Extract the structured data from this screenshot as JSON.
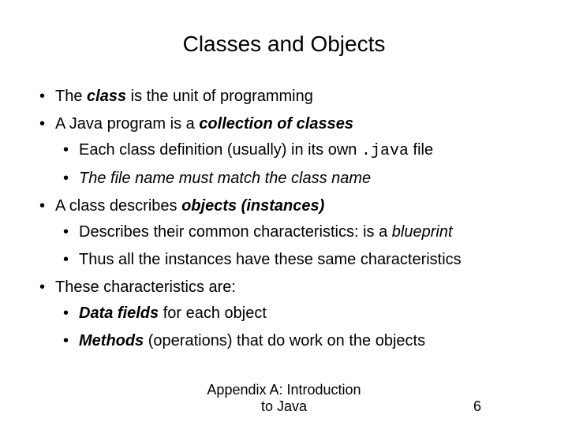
{
  "title": "Classes and Objects",
  "bullets": {
    "b1_pre": "The ",
    "b1_bold": "class",
    "b1_post": " is the unit of programming",
    "b2_pre": "A Java program is a ",
    "b2_bold": "collection of classes",
    "b2s1_pre": "Each class definition (usually) in its own ",
    "b2s1_mono": ".java",
    "b2s1_post": " file",
    "b2s2": "The file name must match the class name",
    "b3_pre": "A class describes ",
    "b3_bold": "objects (instances)",
    "b3s1_pre": "Describes their common characteristics: is a ",
    "b3s1_italic": "blueprint",
    "b3s2": "Thus all the instances have these same characteristics",
    "b4": "These characteristics are:",
    "b4s1_bold": "Data fields",
    "b4s1_post": " for each object",
    "b4s2_bold": "Methods",
    "b4s2_post": " (operations) that do work on the objects"
  },
  "footer": {
    "line1": "Appendix A: Introduction",
    "line2": "to Java",
    "page": "6"
  }
}
